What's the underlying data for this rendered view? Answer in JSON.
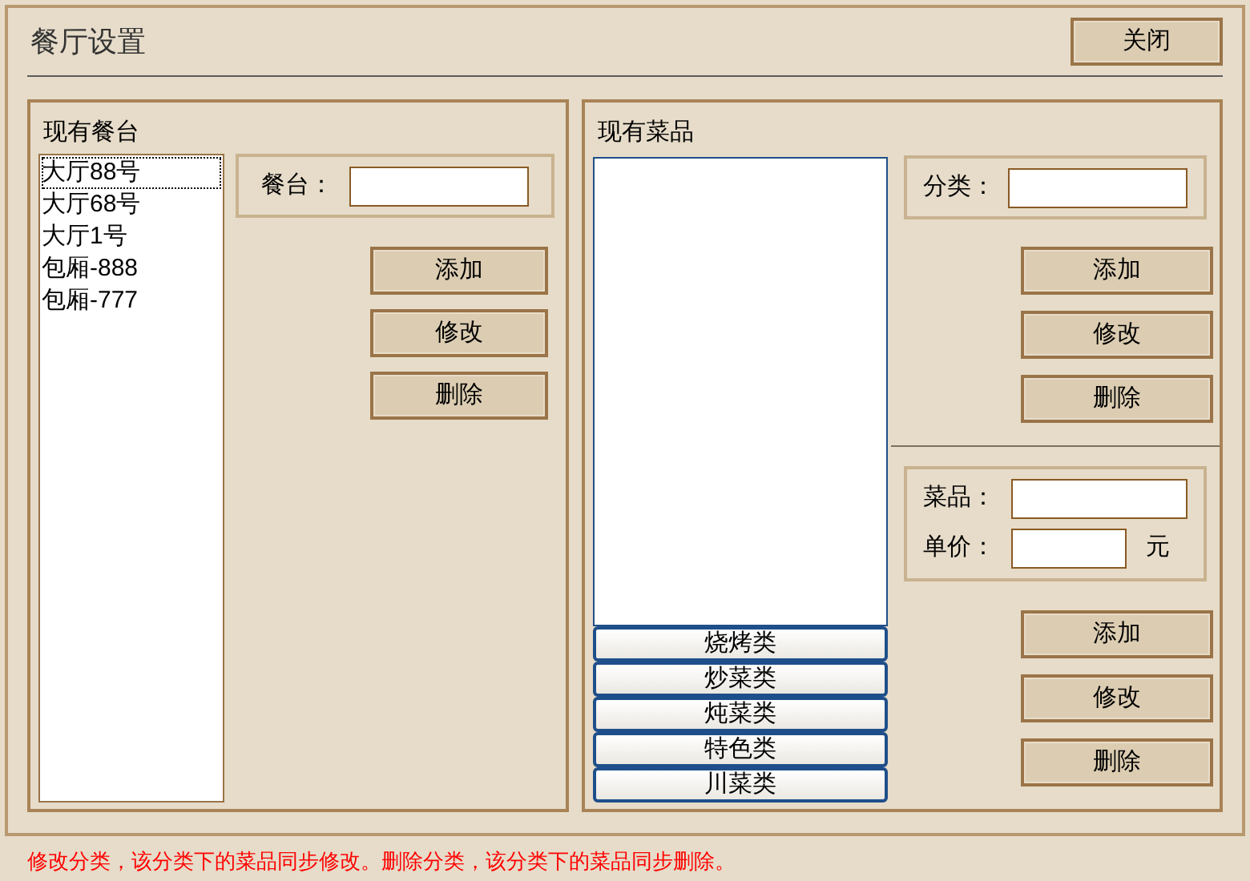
{
  "window": {
    "title": "餐厅设置",
    "close_button": "关闭"
  },
  "tables_panel": {
    "title": "现有餐台",
    "items": [
      {
        "label": "大厅88号",
        "selected": true
      },
      {
        "label": "大厅68号",
        "selected": false
      },
      {
        "label": "大厅1号",
        "selected": false
      },
      {
        "label": "包厢-888",
        "selected": false
      },
      {
        "label": "包厢-777",
        "selected": false
      }
    ],
    "field_label": "餐台：",
    "buttons": [
      "添加",
      "修改",
      "删除"
    ]
  },
  "dishes_panel": {
    "title": "现有菜品",
    "categories": [
      "烧烤类",
      "炒菜类",
      "炖菜类",
      "特色类",
      "川菜类"
    ],
    "category_field_label": "分类：",
    "category_buttons": [
      "添加",
      "修改",
      "删除"
    ],
    "dish_field_label": "菜品：",
    "price_field_label": "单价：",
    "price_unit": "元",
    "dish_buttons": [
      "添加",
      "修改",
      "删除"
    ]
  },
  "footer_note": "修改分类，该分类下的菜品同步修改。删除分类，该分类下的菜品同步删除。"
}
